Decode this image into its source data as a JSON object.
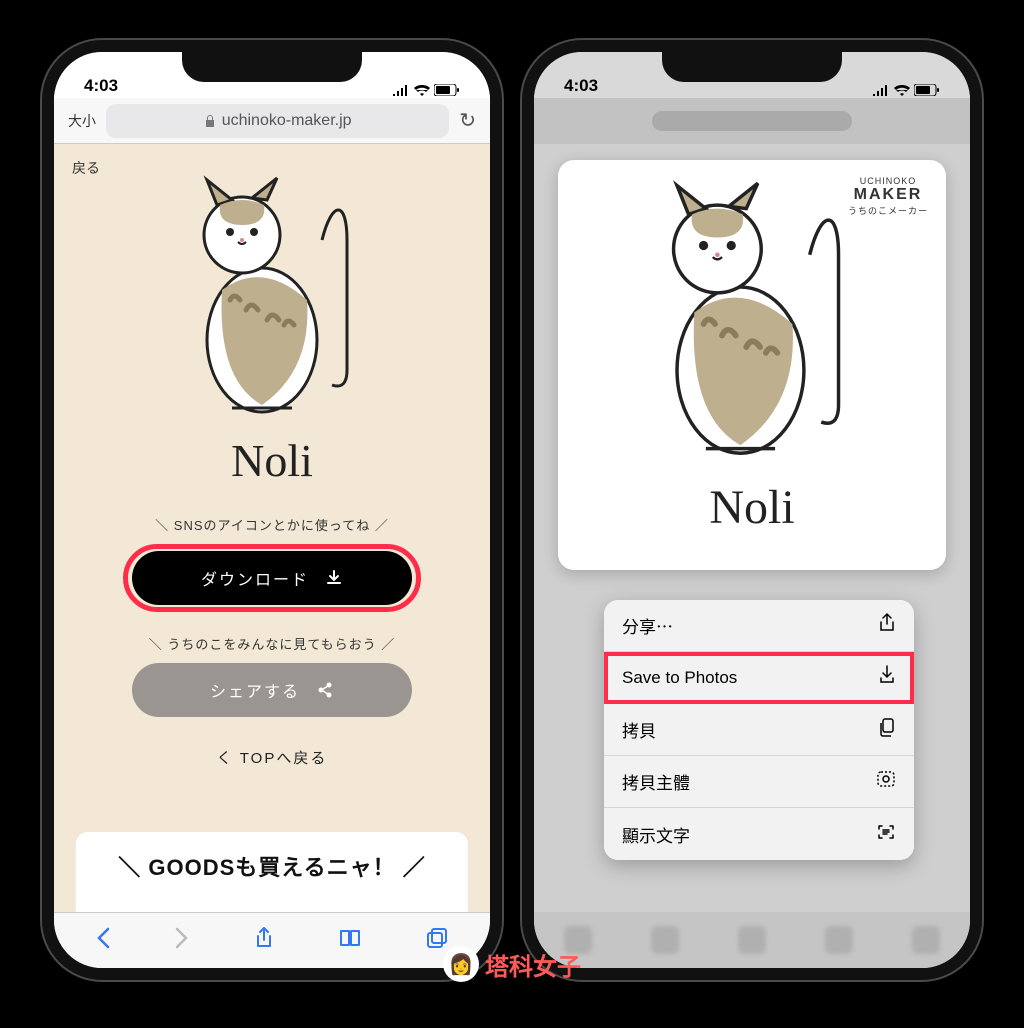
{
  "status": {
    "time": "4:03"
  },
  "left": {
    "safari": {
      "aa": "大小",
      "url": "uchinoko-maker.jp"
    },
    "page": {
      "back": "戻る",
      "cat_name": "Noli",
      "download_hint": "SNSのアイコンとかに使ってね",
      "download_label": "ダウンロード",
      "share_hint": "うちのこをみんなに見てもらおう",
      "share_label": "シェアする",
      "back_top": "く TOPへ戻る",
      "goods_peek": "＼ GOODSも買えるニャ！ ／"
    }
  },
  "right": {
    "brand": {
      "line1": "UCHINOKO",
      "line2": "MAKER",
      "line3": "うちのこメーカー"
    },
    "cat_name": "Noli",
    "menu": {
      "share": "分享⋯",
      "save": "Save to Photos",
      "copy": "拷貝",
      "copy_subject": "拷貝主體",
      "show_text": "顯示文字"
    }
  },
  "watermark": "塔科女子"
}
